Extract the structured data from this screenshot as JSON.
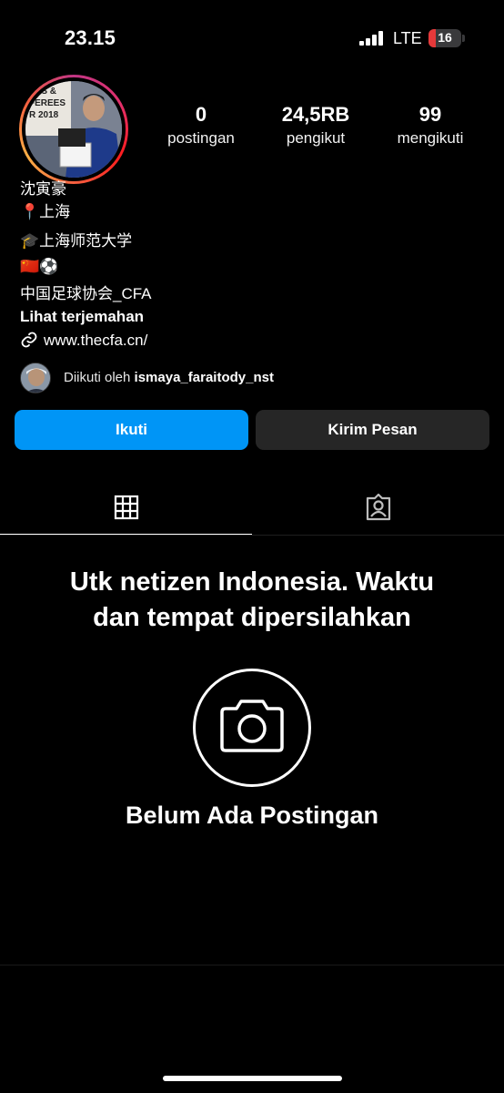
{
  "status_bar": {
    "time": "23.15",
    "network": "LTE",
    "battery_level": "16",
    "battery_color": "#e5393a"
  },
  "profile": {
    "avatar_icon": "profile-photo",
    "stats": [
      {
        "value": "0",
        "label": "postingan"
      },
      {
        "value": "24,5RB",
        "label": "pengikut"
      },
      {
        "value": "99",
        "label": "mengikuti"
      }
    ]
  },
  "bio": {
    "name": "沈寅豪",
    "location": "📍上海",
    "education": "🎓上海师范大学",
    "emojis": "🇨🇳⚽",
    "org": "中国足球协会_CFA",
    "translate": "Lihat terjemahan",
    "link": "www.thecfa.cn/",
    "link_icon": "link-icon"
  },
  "followed_by": {
    "prefix": "Diikuti oleh ",
    "user": "ismaya_faraitody_nst"
  },
  "actions": {
    "follow_label": "Ikuti",
    "message_label": "Kirim Pesan",
    "follow_color": "#0095f6"
  },
  "tabs": [
    {
      "icon": "grid-icon",
      "active": true
    },
    {
      "icon": "tagged-icon",
      "active": false
    }
  ],
  "empty_state": {
    "note_line1": "Utk netizen Indonesia. Waktu",
    "note_line2": "dan tempat dipersilahkan",
    "icon": "camera-icon",
    "title": "Belum Ada Postingan"
  }
}
